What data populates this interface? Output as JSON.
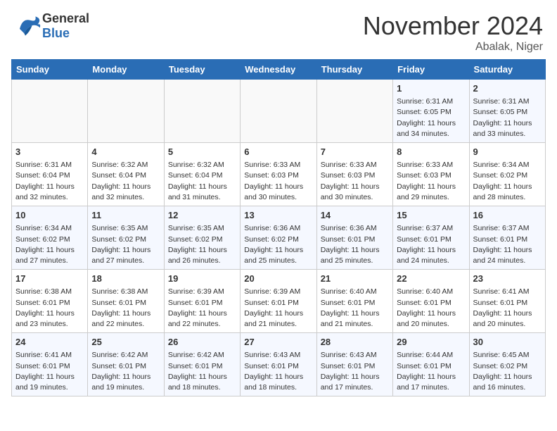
{
  "header": {
    "logo_general": "General",
    "logo_blue": "Blue",
    "month_title": "November 2024",
    "location": "Abalak, Niger"
  },
  "weekdays": [
    "Sunday",
    "Monday",
    "Tuesday",
    "Wednesday",
    "Thursday",
    "Friday",
    "Saturday"
  ],
  "weeks": [
    [
      {
        "day": "",
        "info": ""
      },
      {
        "day": "",
        "info": ""
      },
      {
        "day": "",
        "info": ""
      },
      {
        "day": "",
        "info": ""
      },
      {
        "day": "",
        "info": ""
      },
      {
        "day": "1",
        "info": "Sunrise: 6:31 AM\nSunset: 6:05 PM\nDaylight: 11 hours and 34 minutes."
      },
      {
        "day": "2",
        "info": "Sunrise: 6:31 AM\nSunset: 6:05 PM\nDaylight: 11 hours and 33 minutes."
      }
    ],
    [
      {
        "day": "3",
        "info": "Sunrise: 6:31 AM\nSunset: 6:04 PM\nDaylight: 11 hours and 32 minutes."
      },
      {
        "day": "4",
        "info": "Sunrise: 6:32 AM\nSunset: 6:04 PM\nDaylight: 11 hours and 32 minutes."
      },
      {
        "day": "5",
        "info": "Sunrise: 6:32 AM\nSunset: 6:04 PM\nDaylight: 11 hours and 31 minutes."
      },
      {
        "day": "6",
        "info": "Sunrise: 6:33 AM\nSunset: 6:03 PM\nDaylight: 11 hours and 30 minutes."
      },
      {
        "day": "7",
        "info": "Sunrise: 6:33 AM\nSunset: 6:03 PM\nDaylight: 11 hours and 30 minutes."
      },
      {
        "day": "8",
        "info": "Sunrise: 6:33 AM\nSunset: 6:03 PM\nDaylight: 11 hours and 29 minutes."
      },
      {
        "day": "9",
        "info": "Sunrise: 6:34 AM\nSunset: 6:02 PM\nDaylight: 11 hours and 28 minutes."
      }
    ],
    [
      {
        "day": "10",
        "info": "Sunrise: 6:34 AM\nSunset: 6:02 PM\nDaylight: 11 hours and 27 minutes."
      },
      {
        "day": "11",
        "info": "Sunrise: 6:35 AM\nSunset: 6:02 PM\nDaylight: 11 hours and 27 minutes."
      },
      {
        "day": "12",
        "info": "Sunrise: 6:35 AM\nSunset: 6:02 PM\nDaylight: 11 hours and 26 minutes."
      },
      {
        "day": "13",
        "info": "Sunrise: 6:36 AM\nSunset: 6:02 PM\nDaylight: 11 hours and 25 minutes."
      },
      {
        "day": "14",
        "info": "Sunrise: 6:36 AM\nSunset: 6:01 PM\nDaylight: 11 hours and 25 minutes."
      },
      {
        "day": "15",
        "info": "Sunrise: 6:37 AM\nSunset: 6:01 PM\nDaylight: 11 hours and 24 minutes."
      },
      {
        "day": "16",
        "info": "Sunrise: 6:37 AM\nSunset: 6:01 PM\nDaylight: 11 hours and 24 minutes."
      }
    ],
    [
      {
        "day": "17",
        "info": "Sunrise: 6:38 AM\nSunset: 6:01 PM\nDaylight: 11 hours and 23 minutes."
      },
      {
        "day": "18",
        "info": "Sunrise: 6:38 AM\nSunset: 6:01 PM\nDaylight: 11 hours and 22 minutes."
      },
      {
        "day": "19",
        "info": "Sunrise: 6:39 AM\nSunset: 6:01 PM\nDaylight: 11 hours and 22 minutes."
      },
      {
        "day": "20",
        "info": "Sunrise: 6:39 AM\nSunset: 6:01 PM\nDaylight: 11 hours and 21 minutes."
      },
      {
        "day": "21",
        "info": "Sunrise: 6:40 AM\nSunset: 6:01 PM\nDaylight: 11 hours and 21 minutes."
      },
      {
        "day": "22",
        "info": "Sunrise: 6:40 AM\nSunset: 6:01 PM\nDaylight: 11 hours and 20 minutes."
      },
      {
        "day": "23",
        "info": "Sunrise: 6:41 AM\nSunset: 6:01 PM\nDaylight: 11 hours and 20 minutes."
      }
    ],
    [
      {
        "day": "24",
        "info": "Sunrise: 6:41 AM\nSunset: 6:01 PM\nDaylight: 11 hours and 19 minutes."
      },
      {
        "day": "25",
        "info": "Sunrise: 6:42 AM\nSunset: 6:01 PM\nDaylight: 11 hours and 19 minutes."
      },
      {
        "day": "26",
        "info": "Sunrise: 6:42 AM\nSunset: 6:01 PM\nDaylight: 11 hours and 18 minutes."
      },
      {
        "day": "27",
        "info": "Sunrise: 6:43 AM\nSunset: 6:01 PM\nDaylight: 11 hours and 18 minutes."
      },
      {
        "day": "28",
        "info": "Sunrise: 6:43 AM\nSunset: 6:01 PM\nDaylight: 11 hours and 17 minutes."
      },
      {
        "day": "29",
        "info": "Sunrise: 6:44 AM\nSunset: 6:01 PM\nDaylight: 11 hours and 17 minutes."
      },
      {
        "day": "30",
        "info": "Sunrise: 6:45 AM\nSunset: 6:02 PM\nDaylight: 11 hours and 16 minutes."
      }
    ]
  ]
}
